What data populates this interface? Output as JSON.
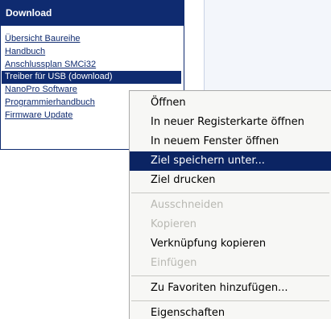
{
  "download_panel": {
    "title": "Download",
    "links": [
      {
        "label": "Übersicht Baureihe"
      },
      {
        "label": "Handbuch"
      },
      {
        "label": "Anschlussplan SMCi32"
      },
      {
        "label": "Treiber für USB (download)",
        "selected": true
      },
      {
        "label": "NanoPro Software"
      },
      {
        "label": "Programmierhandbuch"
      },
      {
        "label": "Firmware Update"
      }
    ]
  },
  "context_menu": {
    "items": [
      {
        "label": "Öffnen"
      },
      {
        "label": "In neuer Registerkarte öffnen"
      },
      {
        "label": "In neuem Fenster öffnen"
      },
      {
        "label": "Ziel speichern unter...",
        "highlighted": true
      },
      {
        "label": "Ziel drucken"
      },
      {
        "label": "Ausschneiden",
        "disabled": true
      },
      {
        "label": "Kopieren",
        "disabled": true
      },
      {
        "label": "Verknüpfung kopieren"
      },
      {
        "label": "Einfügen",
        "disabled": true
      },
      {
        "label": "Zu Favoriten hinzufügen..."
      },
      {
        "label": "Eigenschaften"
      }
    ]
  },
  "colors": {
    "panel_navy": "#0f2b70",
    "menu_highlight": "#0b2463",
    "menu_background": "#f7f7f5",
    "disabled_text": "#b8b8b2"
  }
}
